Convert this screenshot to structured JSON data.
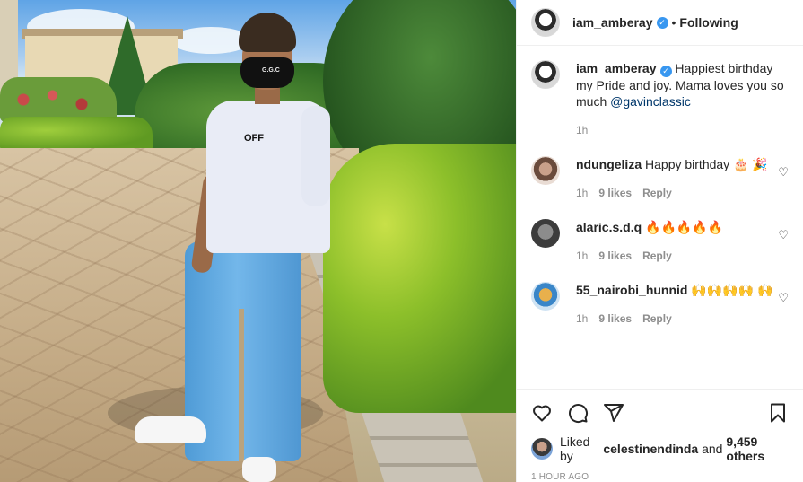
{
  "post": {
    "author": "iam_amberay",
    "follow_status": "Following",
    "caption_text": "Happiest birthday my Pride and joy. Mama loves you so much",
    "caption_mention": "@gavinclassic",
    "caption_time": "1h",
    "image_mask_text": "G.G.C",
    "image_shirt_text": "OFF"
  },
  "comments": [
    {
      "user": "ndungeliza",
      "text": "Happy birthday 🎂 🎉",
      "time": "1h",
      "likes": "9 likes",
      "reply": "Reply"
    },
    {
      "user": "alaric.s.d.q",
      "text": "🔥🔥🔥🔥🔥",
      "time": "1h",
      "likes": "9 likes",
      "reply": "Reply"
    },
    {
      "user": "55_nairobi_hunnid",
      "text": "🙌🙌🙌🙌 🙌",
      "time": "1h",
      "likes": "9 likes",
      "reply": "Reply"
    }
  ],
  "likes": {
    "prefix": "Liked by",
    "user": "celestinendinda",
    "connector": "and",
    "others": "9,459 others"
  },
  "time_ago": "1 HOUR AGO",
  "icons": {
    "like": "heart-icon",
    "comment": "comment-icon",
    "share": "share-icon",
    "save": "bookmark-icon",
    "verified": "verified-badge-icon",
    "comment_like": "heart-icon"
  },
  "colors": {
    "verified": "#3897f0",
    "mention": "#00376b",
    "secondary_text": "#8e8e8e"
  }
}
